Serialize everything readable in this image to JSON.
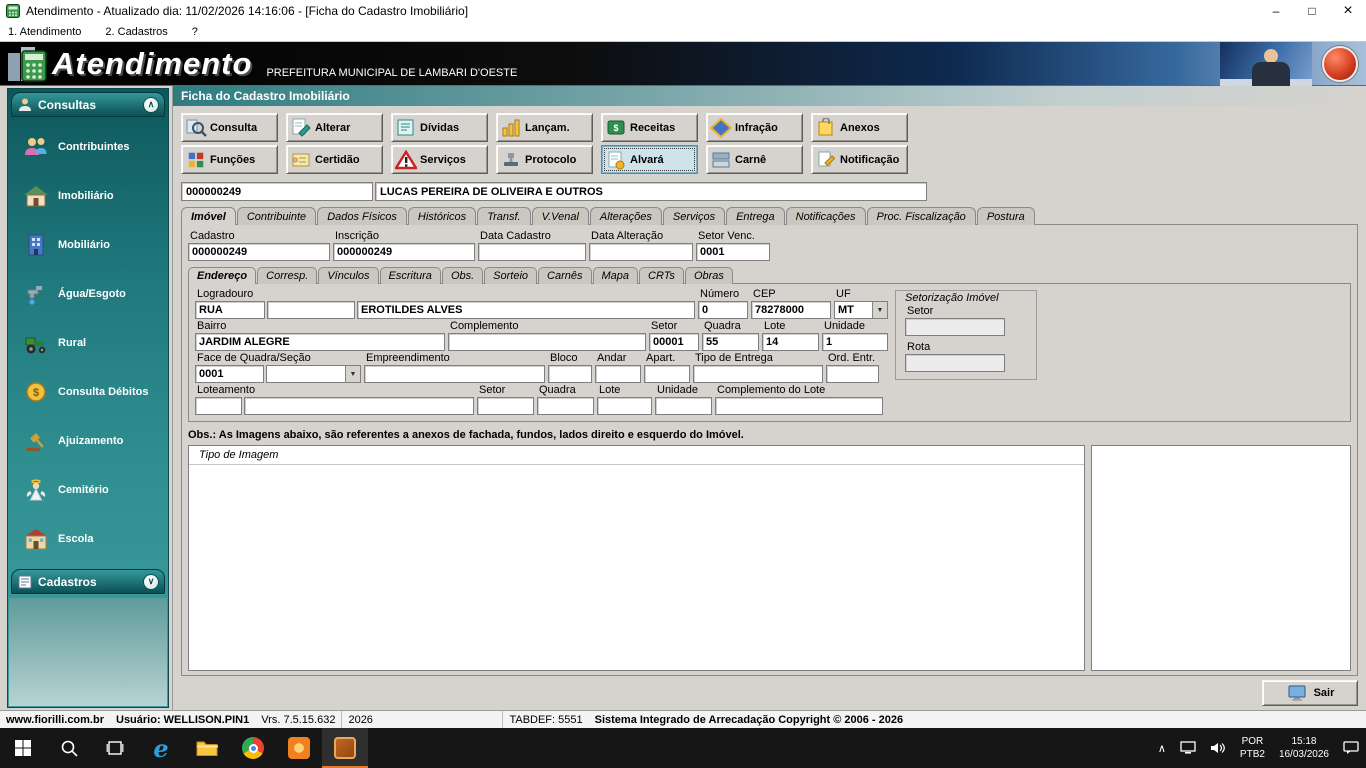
{
  "window": {
    "title": "Atendimento - Atualizado dia: 11/02/2026 14:16:06 - [Ficha do Cadastro Imobiliário]",
    "controls": {
      "minimize": "–",
      "maximize": "□",
      "close": "×"
    }
  },
  "icons": {
    "dropdown": "▼",
    "collapse_up": "∧",
    "collapse_down": "∨"
  },
  "menubar": {
    "items": [
      "1. Atendimento",
      "2. Cadastros",
      "?"
    ]
  },
  "banner": {
    "app_name": "Atendimento",
    "subtitle": "PREFEITURA MUNICIPAL DE LAMBARI D'OESTE"
  },
  "sidebar": {
    "consultas": {
      "label": "Consultas",
      "items": [
        {
          "label": "Contribuintes",
          "icon": "people-icon"
        },
        {
          "label": "Imobiliário",
          "icon": "house-icon"
        },
        {
          "label": "Mobiliário",
          "icon": "building-icon"
        },
        {
          "label": "Água/Esgoto",
          "icon": "faucet-icon"
        },
        {
          "label": "Rural",
          "icon": "tractor-icon"
        },
        {
          "label": "Consulta Débitos",
          "icon": "coin-icon"
        },
        {
          "label": "Ajuizamento",
          "icon": "gavel-icon"
        },
        {
          "label": "Cemitério",
          "icon": "angel-icon"
        },
        {
          "label": "Escola",
          "icon": "school-icon"
        }
      ]
    },
    "cadastros": {
      "label": "Cadastros"
    }
  },
  "content": {
    "page_title": "Ficha do Cadastro Imobiliário",
    "toolbar": {
      "row1": [
        {
          "label": "Consulta",
          "icon": "magnifier-icon"
        },
        {
          "label": "Alterar",
          "icon": "edit-icon"
        },
        {
          "label": "Dívidas",
          "icon": "ledger-icon"
        },
        {
          "label": "Lançam.",
          "icon": "bar-chart-icon"
        },
        {
          "label": "Receitas",
          "icon": "revenue-icon"
        },
        {
          "label": "Infração",
          "icon": "infraction-icon"
        },
        {
          "label": "Anexos",
          "icon": "attachment-icon"
        }
      ],
      "row2": [
        {
          "label": "Funções",
          "icon": "functions-icon"
        },
        {
          "label": "Certidão",
          "icon": "certificate-icon"
        },
        {
          "label": "Serviços",
          "icon": "warning-icon"
        },
        {
          "label": "Protocolo",
          "icon": "stamp-icon"
        },
        {
          "label": "Alvará",
          "icon": "license-icon",
          "selected": true
        },
        {
          "label": "Carnê",
          "icon": "booklet-icon"
        },
        {
          "label": "Notificação",
          "icon": "notice-icon"
        }
      ]
    },
    "record": {
      "code": "000000249",
      "owner": "LUCAS PEREIRA DE OLIVEIRA E OUTROS"
    },
    "tabs": [
      "Imóvel",
      "Contribuinte",
      "Dados Físicos",
      "Históricos",
      "Transf.",
      "V.Venal",
      "Alterações",
      "Serviços",
      "Entrega",
      "Notificações",
      "Proc. Fiscalização",
      "Postura"
    ],
    "fields": {
      "cadastro": {
        "label": "Cadastro",
        "value": "000000249"
      },
      "inscricao": {
        "label": "Inscrição",
        "value": "000000249"
      },
      "data_cadastro": {
        "label": "Data Cadastro",
        "value": ""
      },
      "data_alteracao": {
        "label": "Data Alteração",
        "value": ""
      },
      "setor_venc": {
        "label": "Setor Venc.",
        "value": "0001"
      }
    },
    "subtabs": [
      "Endereço",
      "Corresp.",
      "Vínculos",
      "Escritura",
      "Obs.",
      "Sorteio",
      "Carnês",
      "Mapa",
      "CRTs",
      "Obras"
    ],
    "address": {
      "logradouro": {
        "label": "Logradouro",
        "tipo": "RUA",
        "codigo": "",
        "nome": "EROTILDES ALVES"
      },
      "numero": {
        "label": "Número",
        "value": "0"
      },
      "cep": {
        "label": "CEP",
        "value": "78278000"
      },
      "uf": {
        "label": "UF",
        "value": "MT"
      },
      "bairro": {
        "label": "Bairro",
        "value": "JARDIM ALEGRE"
      },
      "complemento": {
        "label": "Complemento",
        "value": ""
      },
      "setor": {
        "label": "Setor",
        "value": "00001"
      },
      "quadra": {
        "label": "Quadra",
        "value": "55"
      },
      "lote": {
        "label": "Lote",
        "value": "14"
      },
      "unidade": {
        "label": "Unidade",
        "value": "1"
      },
      "face_quadra": {
        "label": "Face de Quadra/Seção",
        "value": "0001",
        "combo": ""
      },
      "empreendimento": {
        "label": "Empreendimento",
        "value": ""
      },
      "bloco": {
        "label": "Bloco",
        "value": ""
      },
      "andar": {
        "label": "Andar",
        "value": ""
      },
      "apart": {
        "label": "Apart.",
        "value": ""
      },
      "tipo_entrega": {
        "label": "Tipo de Entrega",
        "value": ""
      },
      "ord_entr": {
        "label": "Ord. Entr.",
        "value": ""
      },
      "loteamento": {
        "label": "Loteamento",
        "codigo": "",
        "nome": ""
      },
      "setor2": {
        "label": "Setor",
        "value": ""
      },
      "quadra2": {
        "label": "Quadra",
        "value": ""
      },
      "lote2": {
        "label": "Lote",
        "value": ""
      },
      "unidade2": {
        "label": "Unidade",
        "value": ""
      },
      "compl_lote": {
        "label": "Complemento do Lote",
        "value": ""
      }
    },
    "setorizacao": {
      "title": "Setorização Imóvel",
      "setor_label": "Setor",
      "setor": "",
      "rota_label": "Rota",
      "rota": ""
    },
    "obs": "Obs.: As Imagens abaixo, são referentes a anexos de fachada, fundos, lados direito e esquerdo do Imóvel.",
    "images": {
      "header": "Tipo de Imagem"
    },
    "sair": "Sair"
  },
  "statusbar": {
    "site": "www.fiorilli.com.br",
    "user": "Usuário: WELLISON.PIN1",
    "version": "Vrs. 7.5.15.632",
    "year": "2026",
    "tabdef": "TABDEF: 5551",
    "copyright": "Sistema Integrado de Arrecadação Copyright © 2006 - 2026"
  },
  "taskbar": {
    "language": "POR",
    "layout": "PTB2",
    "time": "15:18",
    "date": "16/03/2026"
  }
}
